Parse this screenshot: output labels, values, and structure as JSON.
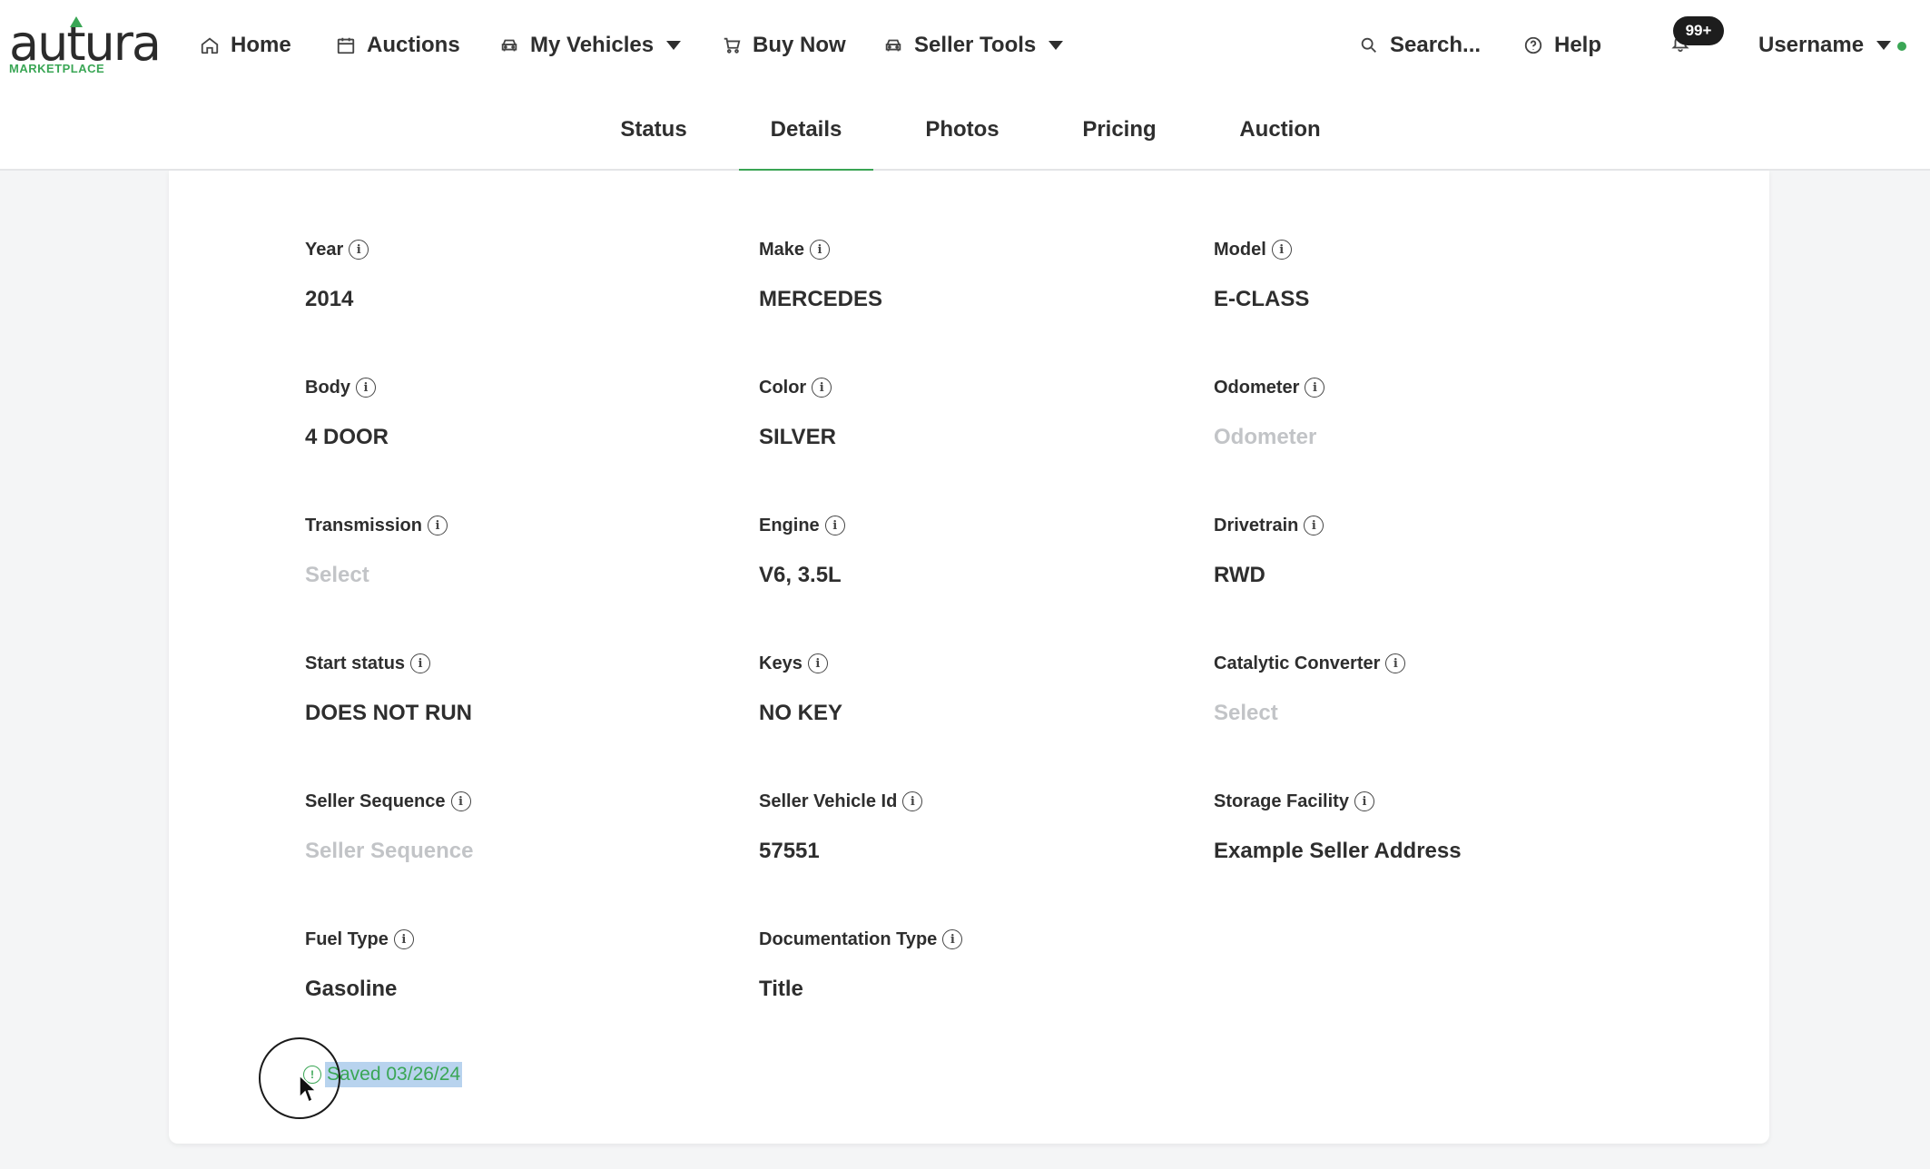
{
  "logo": {
    "word": "autura",
    "sub": "MARKETPLACE"
  },
  "nav": {
    "home": "Home",
    "auctions": "Auctions",
    "my_vehicles": "My Vehicles",
    "buy_now": "Buy Now",
    "seller_tools": "Seller Tools",
    "search": "Search...",
    "help": "Help",
    "notifications_badge": "99+",
    "username": "Username"
  },
  "tabs": [
    "Status",
    "Details",
    "Photos",
    "Pricing",
    "Auction"
  ],
  "active_tab": "Details",
  "fields": {
    "year": {
      "label": "Year",
      "value": "2014"
    },
    "make": {
      "label": "Make",
      "value": "MERCEDES"
    },
    "model": {
      "label": "Model",
      "value": "E-CLASS"
    },
    "body": {
      "label": "Body",
      "value": "4 DOOR"
    },
    "color": {
      "label": "Color",
      "value": "SILVER"
    },
    "odometer": {
      "label": "Odometer",
      "placeholder": "Odometer"
    },
    "transmission": {
      "label": "Transmission",
      "placeholder": "Select"
    },
    "engine": {
      "label": "Engine",
      "value": "V6, 3.5L"
    },
    "drivetrain": {
      "label": "Drivetrain",
      "value": "RWD"
    },
    "start_status": {
      "label": "Start status",
      "value": "DOES NOT RUN"
    },
    "keys": {
      "label": "Keys",
      "value": "NO KEY"
    },
    "catalytic_converter": {
      "label": "Catalytic Converter",
      "placeholder": "Select"
    },
    "seller_sequence": {
      "label": "Seller Sequence",
      "placeholder": "Seller Sequence"
    },
    "seller_vehicle_id": {
      "label": "Seller Vehicle Id",
      "value": "57551"
    },
    "storage_facility": {
      "label": "Storage Facility",
      "value": "Example Seller Address"
    },
    "fuel_type": {
      "label": "Fuel Type",
      "value": "Gasoline"
    },
    "documentation_type": {
      "label": "Documentation Type",
      "value": "Title"
    }
  },
  "saved_status": "Saved 03/26/24",
  "colors": {
    "accent": "#3aa655",
    "selection": "#b8d3ee",
    "placeholder": "#c2c4c7"
  }
}
